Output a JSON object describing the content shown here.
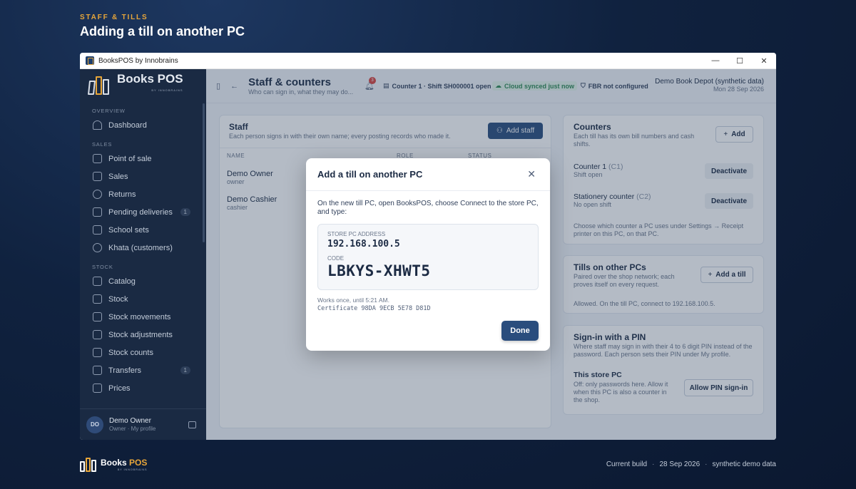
{
  "header": {
    "eyebrow": "STAFF & TILLS",
    "title": "Adding a till on another PC"
  },
  "window": {
    "title": "BooksPOS by Innobrains",
    "minimize": "—",
    "maximize": "☐",
    "close": "✕"
  },
  "sidebar": {
    "logo_text": "Books POS",
    "logo_sub": "BY INNOBRAINS",
    "sections": [
      {
        "label": "OVERVIEW"
      },
      {
        "label": "SALES"
      },
      {
        "label": "STOCK"
      }
    ],
    "items": [
      {
        "label": "Dashboard"
      },
      {
        "label": "Point of sale"
      },
      {
        "label": "Sales"
      },
      {
        "label": "Returns"
      },
      {
        "label": "Pending deliveries",
        "badge": "1"
      },
      {
        "label": "School sets"
      },
      {
        "label": "Khata (customers)"
      },
      {
        "label": "Catalog"
      },
      {
        "label": "Stock"
      },
      {
        "label": "Stock movements"
      },
      {
        "label": "Stock adjustments"
      },
      {
        "label": "Stock counts"
      },
      {
        "label": "Transfers",
        "badge": "1"
      },
      {
        "label": "Prices"
      }
    ],
    "user": {
      "initials": "DO",
      "name": "Demo Owner",
      "role": "Owner",
      "sep": " · ",
      "profile": "My profile"
    }
  },
  "topbar": {
    "title": "Staff & counters",
    "subtitle": "Who can sign in, what they may do...",
    "bell_count": "3",
    "counter_chip": "Counter 1 · Shift SH000001 open",
    "cloud_chip": "Cloud synced just now",
    "fbr_chip": "FBR not configured",
    "store_name": "Demo Book Depot (synthetic data)",
    "store_date": "Mon 28 Sep 2026"
  },
  "staff": {
    "title": "Staff",
    "subtitle": "Each person signs in with their own name; every posting records who made it.",
    "add_button": "Add staff",
    "columns": [
      "NAME",
      "ROLE",
      "STATUS"
    ],
    "rows": [
      {
        "name": "Demo Owner",
        "role": "owner"
      },
      {
        "name": "Demo Cashier",
        "role": "cashier"
      }
    ]
  },
  "counters": {
    "title": "Counters",
    "subtitle": "Each till has its own bill numbers and cash shifts.",
    "add_button": "Add",
    "items": [
      {
        "name": "Counter 1",
        "code": "(C1)",
        "status": "Shift open",
        "action": "Deactivate"
      },
      {
        "name": "Stationery counter",
        "code": "(C2)",
        "status": "No open shift",
        "action": "Deactivate"
      }
    ],
    "note": "Choose which counter a PC uses under Settings → Receipt printer on this PC, on that PC."
  },
  "tills": {
    "title": "Tills on other PCs",
    "subtitle": "Paired over the shop network; each proves itself on every request.",
    "add_button": "Add a till",
    "note": "Allowed. On the till PC, connect to 192.168.100.5."
  },
  "pin": {
    "title": "Sign-in with a PIN",
    "subtitle": "Where staff may sign in with their 4 to 6 digit PIN instead of the password. Each person sets their PIN under My profile.",
    "store_pc_title": "This store PC",
    "store_pc_desc": "Off: only passwords here. Allow it when this PC is also a counter in the shop.",
    "allow_button": "Allow PIN sign-in"
  },
  "modal": {
    "title": "Add a till on another PC",
    "close": "✕",
    "instructions": "On the new till PC, open BooksPOS, choose Connect to the store PC, and type:",
    "address_label": "STORE PC ADDRESS",
    "address": "192.168.100.5",
    "code_label": "CODE",
    "code": "LBKYS-XHWT5",
    "expiry": "Works once, until 5:21 AM.",
    "certificate_label": "Certificate",
    "certificate": "98DA 9ECB 5E78 D81D",
    "done": "Done"
  },
  "footer": {
    "logo_books": "Books",
    "logo_pos": "POS",
    "logo_sub": "BY INNOBRAINS",
    "build_label": "Current build",
    "build_date": "28 Sep 2026",
    "build_note": "synthetic demo data",
    "sep": "·"
  }
}
